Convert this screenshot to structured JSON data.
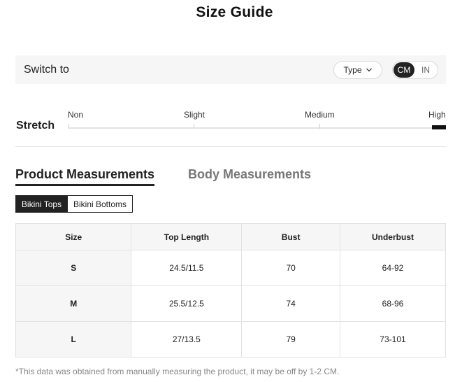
{
  "title": "Size Guide",
  "switch_bar": {
    "label": "Switch to",
    "type_button": "Type",
    "units": [
      "CM",
      "IN"
    ],
    "selected_unit": "CM"
  },
  "stretch": {
    "label": "Stretch",
    "options": [
      "Non",
      "Slight",
      "Medium",
      "High"
    ],
    "selected": "High"
  },
  "tabs": [
    {
      "label": "Product Measurements",
      "active": true
    },
    {
      "label": "Body Measurements",
      "active": false
    }
  ],
  "categories": [
    {
      "label": "Bikini Tops",
      "active": true
    },
    {
      "label": "Bikini Bottoms",
      "active": false
    }
  ],
  "table": {
    "headers": [
      "Size",
      "Top Length",
      "Bust",
      "Underbust"
    ],
    "rows": [
      [
        "S",
        "24.5/11.5",
        "70",
        "64-92"
      ],
      [
        "M",
        "25.5/12.5",
        "74",
        "68-96"
      ],
      [
        "L",
        "27/13.5",
        "79",
        "73-101"
      ]
    ]
  },
  "note": "*This data was obtained from manually measuring the product, it may be off by 1-2 CM."
}
